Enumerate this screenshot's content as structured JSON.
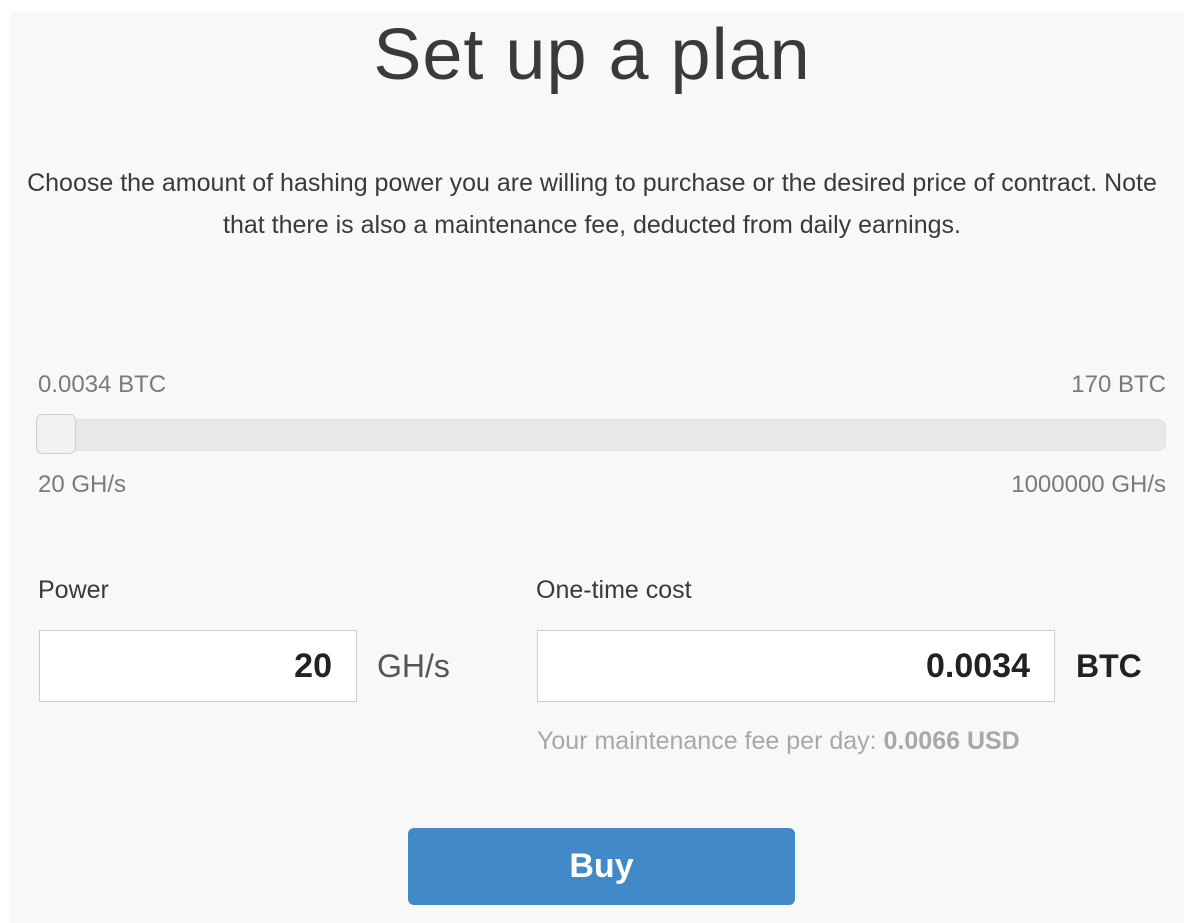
{
  "page": {
    "title": "Set up a plan",
    "description": "Choose the amount of hashing power you are willing to purchase or the desired price of contract. Note that there is also a maintenance fee, deducted from daily earnings."
  },
  "slider": {
    "price_min": "0.0034 BTC",
    "price_max": "170 BTC",
    "power_min": "20 GH/s",
    "power_max": "1000000 GH/s",
    "position": 0
  },
  "power": {
    "label": "Power",
    "value": "20",
    "unit": "GH/s"
  },
  "cost": {
    "label": "One-time cost",
    "value": "0.0034",
    "unit": "BTC"
  },
  "fee": {
    "label": "Your maintenance fee per day:",
    "value": "0.0066 USD"
  },
  "buy_label": "Buy",
  "colors": {
    "accent": "#4189c7",
    "background": "#f8f8f8"
  }
}
